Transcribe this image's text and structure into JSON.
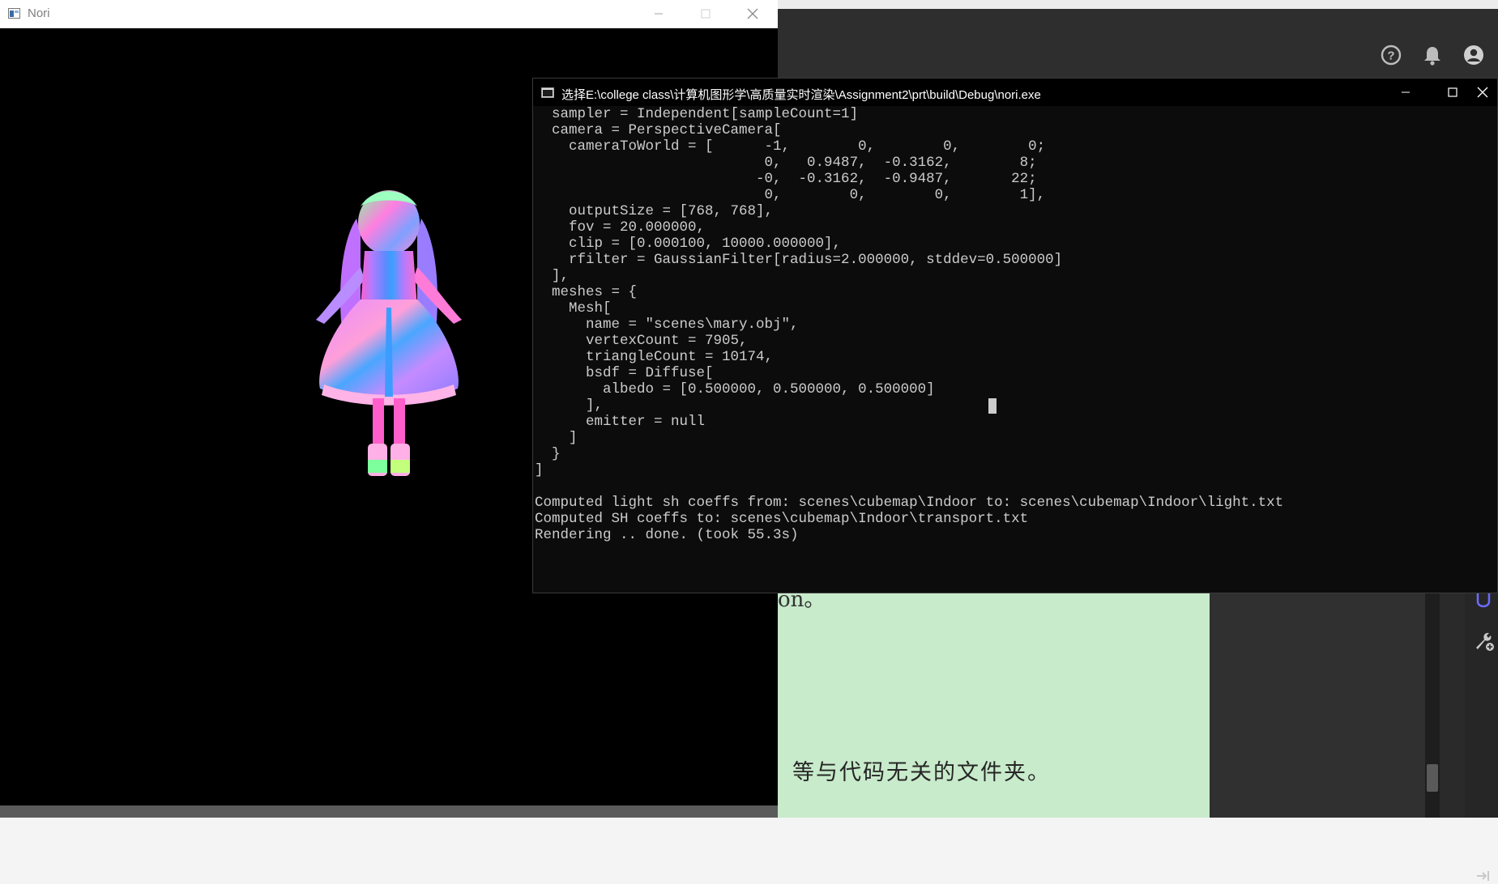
{
  "nori_window": {
    "title": "Nori"
  },
  "console_window": {
    "title": "选择E:\\college class\\计算机图形学\\高质量实时渲染\\Assignment2\\prt\\build\\Debug\\nori.exe",
    "lines": [
      "  sampler = Independent[sampleCount=1]",
      "  camera = PerspectiveCamera[",
      "    cameraToWorld = [      -1,        0,        0,        0;",
      "                           0,   0.9487,  -0.3162,        8;",
      "                          -0,  -0.3162,  -0.9487,       22;",
      "                           0,        0,        0,        1],",
      "    outputSize = [768, 768],",
      "    fov = 20.000000,",
      "    clip = [0.000100, 10000.000000],",
      "    rfilter = GaussianFilter[radius=2.000000, stddev=0.500000]",
      "  ],",
      "  meshes = {",
      "    Mesh[",
      "      name = \"scenes\\mary.obj\",",
      "      vertexCount = 7905,",
      "      triangleCount = 10174,",
      "      bsdf = Diffuse[",
      "        albedo = [0.500000, 0.500000, 0.500000]",
      "      ],",
      "      emitter = null",
      "    ]",
      "  }",
      "]",
      "",
      "Computed light sh coeffs from: scenes\\cubemap\\Indoor to: scenes\\cubemap\\Indoor\\light.txt",
      "Computed SH coeffs to: scenes\\cubemap\\Indoor\\transport.txt",
      "Rendering .. done. (took 55.3s)"
    ]
  },
  "background_doc": {
    "fragment": "on。",
    "line": "等与代码无关的文件夹。"
  },
  "icons": {
    "help": "help-circle-icon",
    "bell": "notification-bell-icon",
    "account": "account-icon",
    "wrench": "wrench-add-icon"
  },
  "colors": {
    "doc_background": "#c8ebcb",
    "console_background": "#0c0c0c",
    "console_text": "#cccccc"
  }
}
